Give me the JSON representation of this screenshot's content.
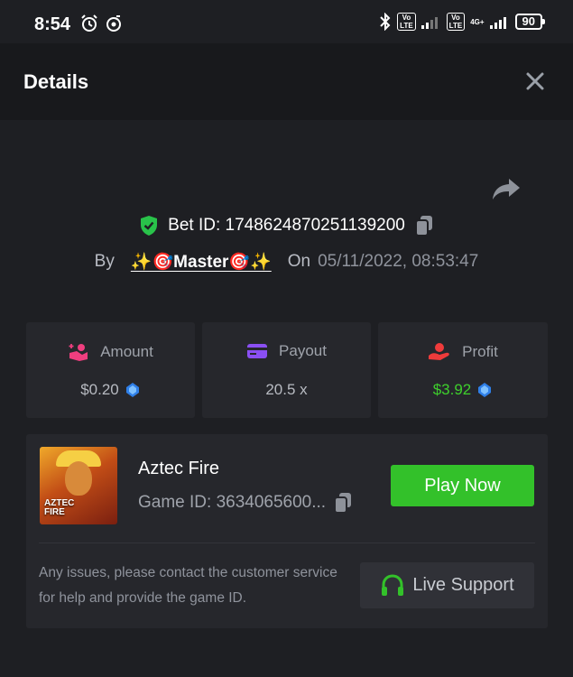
{
  "status_bar": {
    "time": "8:54",
    "volte1": "Vo LTE",
    "volte2": "Vo LTE",
    "network": "4G+",
    "battery": "90"
  },
  "header": {
    "title": "Details"
  },
  "bet": {
    "bet_id_label": "Bet ID: 1748624870251139200",
    "by_label": "By",
    "user": "✨🎯Master🎯✨",
    "on_label": "On",
    "datetime": "05/11/2022, 08:53:47"
  },
  "stats": [
    {
      "label": "Amount",
      "value": "$0.20",
      "icon": "hand-coins-icon"
    },
    {
      "label": "Payout",
      "value": "20.5 x",
      "icon": "card-icon"
    },
    {
      "label": "Profit",
      "value": "$3.92",
      "icon": "hand-profit-icon"
    }
  ],
  "game": {
    "thumb_text": "AZTEC FIRE",
    "title": "Aztec Fire",
    "game_id": "Game ID: 3634065600...",
    "play_label": "Play Now",
    "help_text": "Any issues, please contact the customer service for help and provide the game ID.",
    "support_label": "Live Support"
  },
  "colors": {
    "background": "#1e1f23",
    "card": "#26272c",
    "play_green": "#33c12a",
    "profit_green": "#3ecf2c",
    "shield_green": "#29c24a",
    "amount_pink": "#ef3e7f",
    "payout_purple": "#8a4ff3",
    "profit_red": "#ef3b3b"
  }
}
